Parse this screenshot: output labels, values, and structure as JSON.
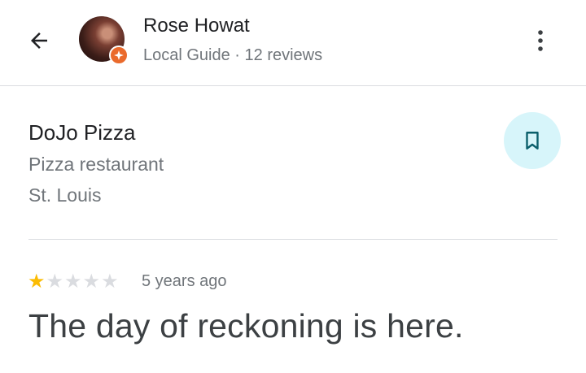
{
  "header": {
    "user_name": "Rose Howat",
    "user_meta": "Local Guide · 12 reviews",
    "back_icon": "arrow-left-icon",
    "more_icon": "more-vertical-icon",
    "badge_icon": "local-guide-star-icon",
    "badge_color": "#ea6a2c"
  },
  "place": {
    "name": "DoJo Pizza",
    "category": "Pizza restaurant",
    "location": "St. Louis",
    "save_icon": "bookmark-icon",
    "save_bg": "#d7f5fa"
  },
  "review": {
    "rating": 1,
    "max_rating": 5,
    "time": "5 years ago",
    "text": "The day of reckoning is here.",
    "star_color": "#fbbc04"
  }
}
